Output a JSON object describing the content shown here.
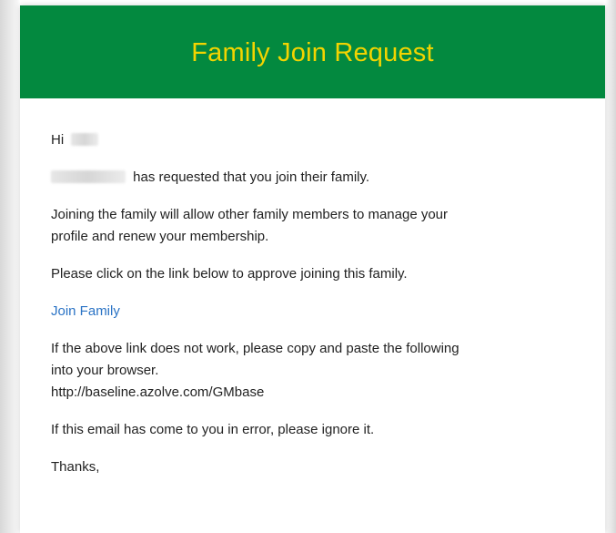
{
  "header": {
    "title": "Family Join Request",
    "background_color": "#03893f",
    "title_color": "#f3d400"
  },
  "email": {
    "greeting": "Hi",
    "request_text": "has requested that you join their family.",
    "benefit_line_1": "Joining the family will allow other family members to manage your",
    "benefit_line_2": "profile and renew your membership.",
    "instruction": "Please click on the link below to approve joining this family.",
    "join_link_label": "Join Family",
    "fallback_line_1": "If the above link does not work, please copy and paste the following",
    "fallback_line_2": "into your browser.",
    "fallback_url": "http://baseline.azolve.com/GMbase",
    "error_note": "If this email has come to you in error, please ignore it.",
    "signoff": "Thanks,",
    "link_color": "#2a73c5"
  }
}
